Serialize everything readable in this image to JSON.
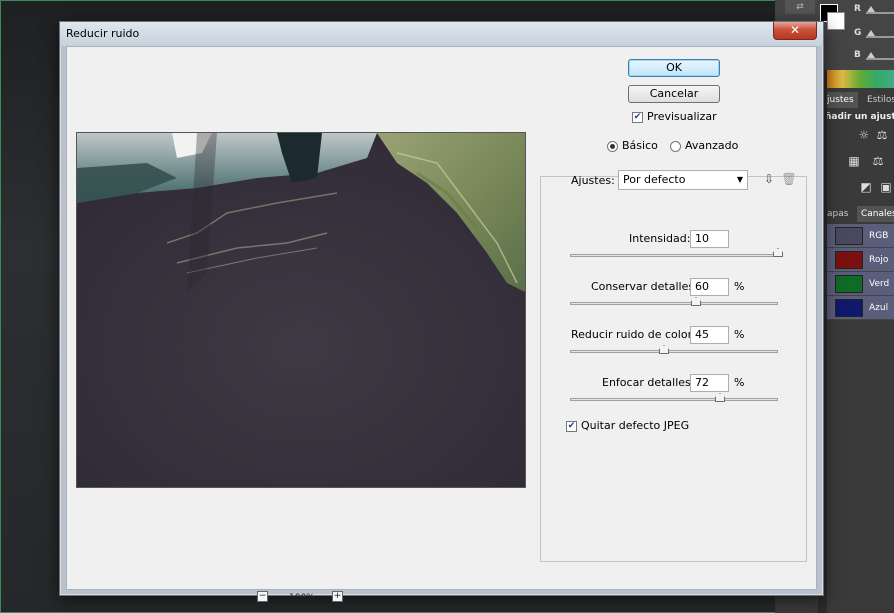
{
  "dialog": {
    "title": "Reducir ruido",
    "close_label": "✕",
    "ok_label": "OK",
    "cancel_label": "Cancelar",
    "preview_label": "Previsualizar",
    "preview_checked": true,
    "mode_basic_label": "Básico",
    "mode_advanced_label": "Avanzado",
    "mode_selected": "Básico",
    "settings_label": "Ajustes:",
    "settings_value": "Por defecto",
    "sliders": [
      {
        "label": "Intensidad:",
        "value": "10",
        "unit": "",
        "fraction": 1.0
      },
      {
        "label": "Conservar detalles:",
        "value": "60",
        "unit": "%",
        "fraction": 0.6
      },
      {
        "label": "Reducir ruido de color:",
        "value": "45",
        "unit": "%",
        "fraction": 0.45
      },
      {
        "label": "Enfocar detalles:",
        "value": "72",
        "unit": "%",
        "fraction": 0.72
      }
    ],
    "jpeg_label": "Quitar defecto JPEG",
    "jpeg_checked": true,
    "zoom_level": "100%",
    "zoom_out": "−",
    "zoom_in": "+"
  },
  "photoshop_panel": {
    "channel_labels": [
      "R",
      "G",
      "B"
    ],
    "tabs_top": [
      "justes",
      "Estilos"
    ],
    "add_adjustment_text": "ñadir un ajust",
    "tabs_bottom": [
      "apas",
      "Canales"
    ],
    "channels": [
      {
        "name": "RGB",
        "color": "#4a4a5e"
      },
      {
        "name": "Rojo",
        "color": "#7a1010"
      },
      {
        "name": "Verd",
        "color": "#106a28"
      },
      {
        "name": "Azul",
        "color": "#10186e"
      }
    ]
  }
}
